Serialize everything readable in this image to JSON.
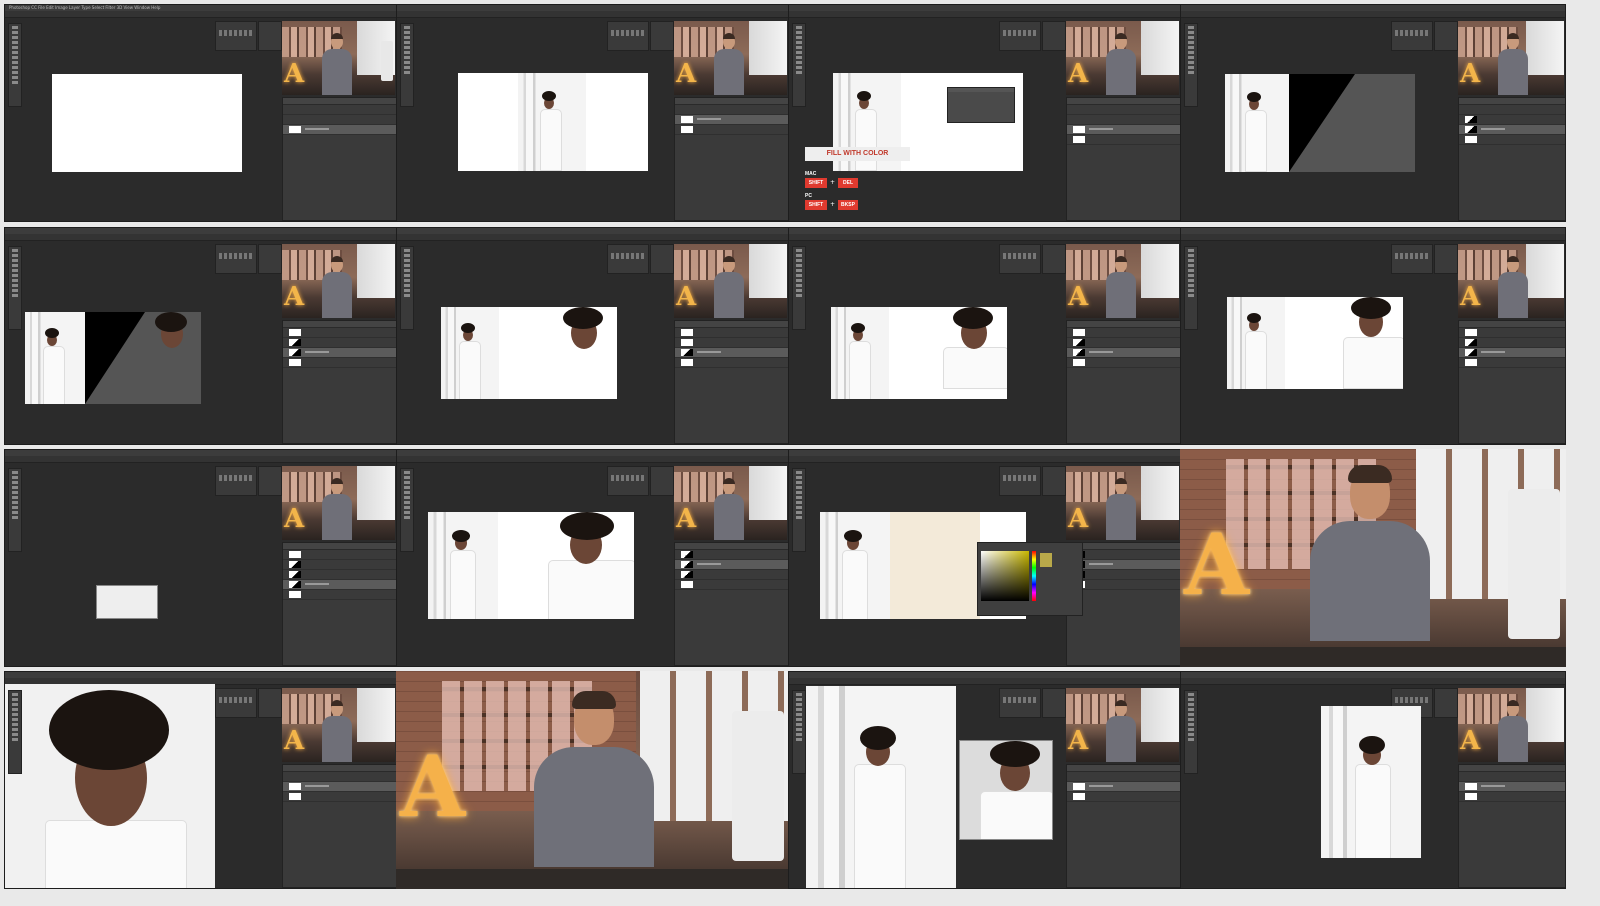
{
  "sheet": {
    "layout": "contact sheet of 16 video frames, 4 columns x 4 rows",
    "background": "#e9e9e9"
  },
  "app": {
    "name": "Photoshop CC",
    "menu_text": "Photoshop CC  File  Edit  Image  Layer  Type  Select  Filter  3D  View  Window  Help"
  },
  "overlay": {
    "title": "FILL WITH COLOR",
    "mac_label": "MAC",
    "mac_keys": [
      "SHIFT",
      "DEL"
    ],
    "pc_label": "PC",
    "pc_keys": [
      "SHIFT",
      "BKSP"
    ],
    "plus": "+",
    "title_color": "#c0392b",
    "key_color": "#e03a2f"
  },
  "colors": {
    "workspace": "#2b2b2b",
    "panel": "#3a3a3a",
    "accent_orange": "#f5b14a"
  },
  "icons": [
    "move-tool-icon",
    "marquee-tool-icon",
    "lasso-tool-icon",
    "crop-tool-icon",
    "brush-tool-icon",
    "eraser-tool-icon",
    "type-tool-icon",
    "hand-tool-icon",
    "zoom-tool-icon"
  ]
}
